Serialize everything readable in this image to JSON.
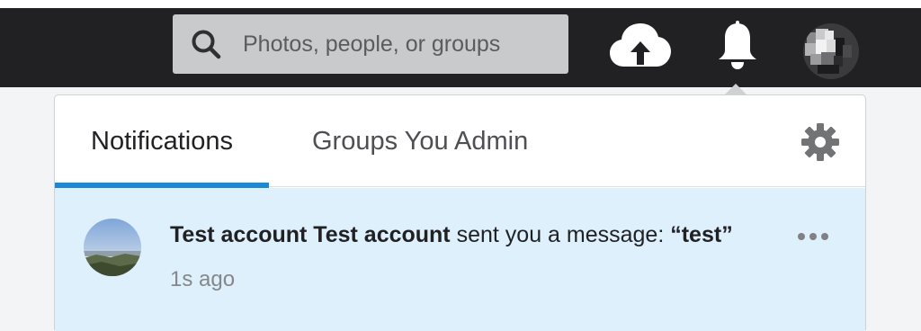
{
  "search": {
    "placeholder": "Photos, people, or groups"
  },
  "icons": {
    "search": "search-icon",
    "upload": "cloud-upload-icon",
    "notifications": "bell-icon",
    "settings": "gear-icon",
    "more": "more-dots-icon"
  },
  "tabs": [
    {
      "label": "Notifications",
      "active": true
    },
    {
      "label": "Groups You Admin",
      "active": false
    }
  ],
  "notification": {
    "actor": "Test account Test account",
    "action": " sent you a message: ",
    "message": "“test”",
    "time": "1s ago"
  },
  "colors": {
    "navbar": "#212124",
    "accent": "#1a8ad6",
    "unread_row": "#def0fc"
  }
}
